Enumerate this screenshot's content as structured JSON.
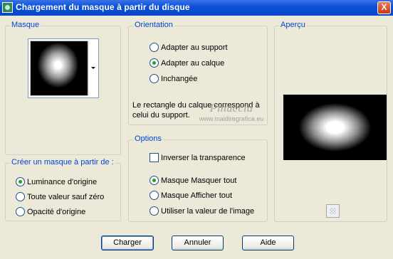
{
  "window": {
    "title": "Chargement du masque à partir du disque",
    "close_glyph": "X"
  },
  "mask_group": {
    "label": "Masque"
  },
  "create_group": {
    "label": "Créer un masque à partir de :",
    "options": [
      {
        "label": "Luminance d'origine",
        "checked": true
      },
      {
        "label": "Toute valeur sauf zéro",
        "checked": false
      },
      {
        "label": "Opacité d'origine",
        "checked": false
      }
    ]
  },
  "orientation_group": {
    "label": "Orientation",
    "options": [
      {
        "label": "Adapter au support",
        "checked": false
      },
      {
        "label": "Adapter au calque",
        "checked": true
      },
      {
        "label": "Inchangée",
        "checked": false
      }
    ],
    "info": "Le rectangle du calque correspond à celui du support."
  },
  "watermark": {
    "brand": "Pinuccia",
    "url": "www.maidiregrafica.eu"
  },
  "options_group": {
    "label": "Options",
    "invert_label": "Inverser la transparence",
    "invert_checked": false,
    "options": [
      {
        "label": "Masque Masquer tout",
        "checked": true
      },
      {
        "label": "Masque Afficher tout",
        "checked": false
      },
      {
        "label": "Utiliser la valeur de l'image",
        "checked": false
      }
    ]
  },
  "preview_group": {
    "label": "Aperçu"
  },
  "buttons": {
    "load": "Charger",
    "cancel": "Annuler",
    "help": "Aide"
  },
  "icons": {
    "app": "app-icon",
    "close": "close-icon",
    "dropdown": "dropdown-arrow-icon",
    "preview": "preview-toggle-icon"
  }
}
